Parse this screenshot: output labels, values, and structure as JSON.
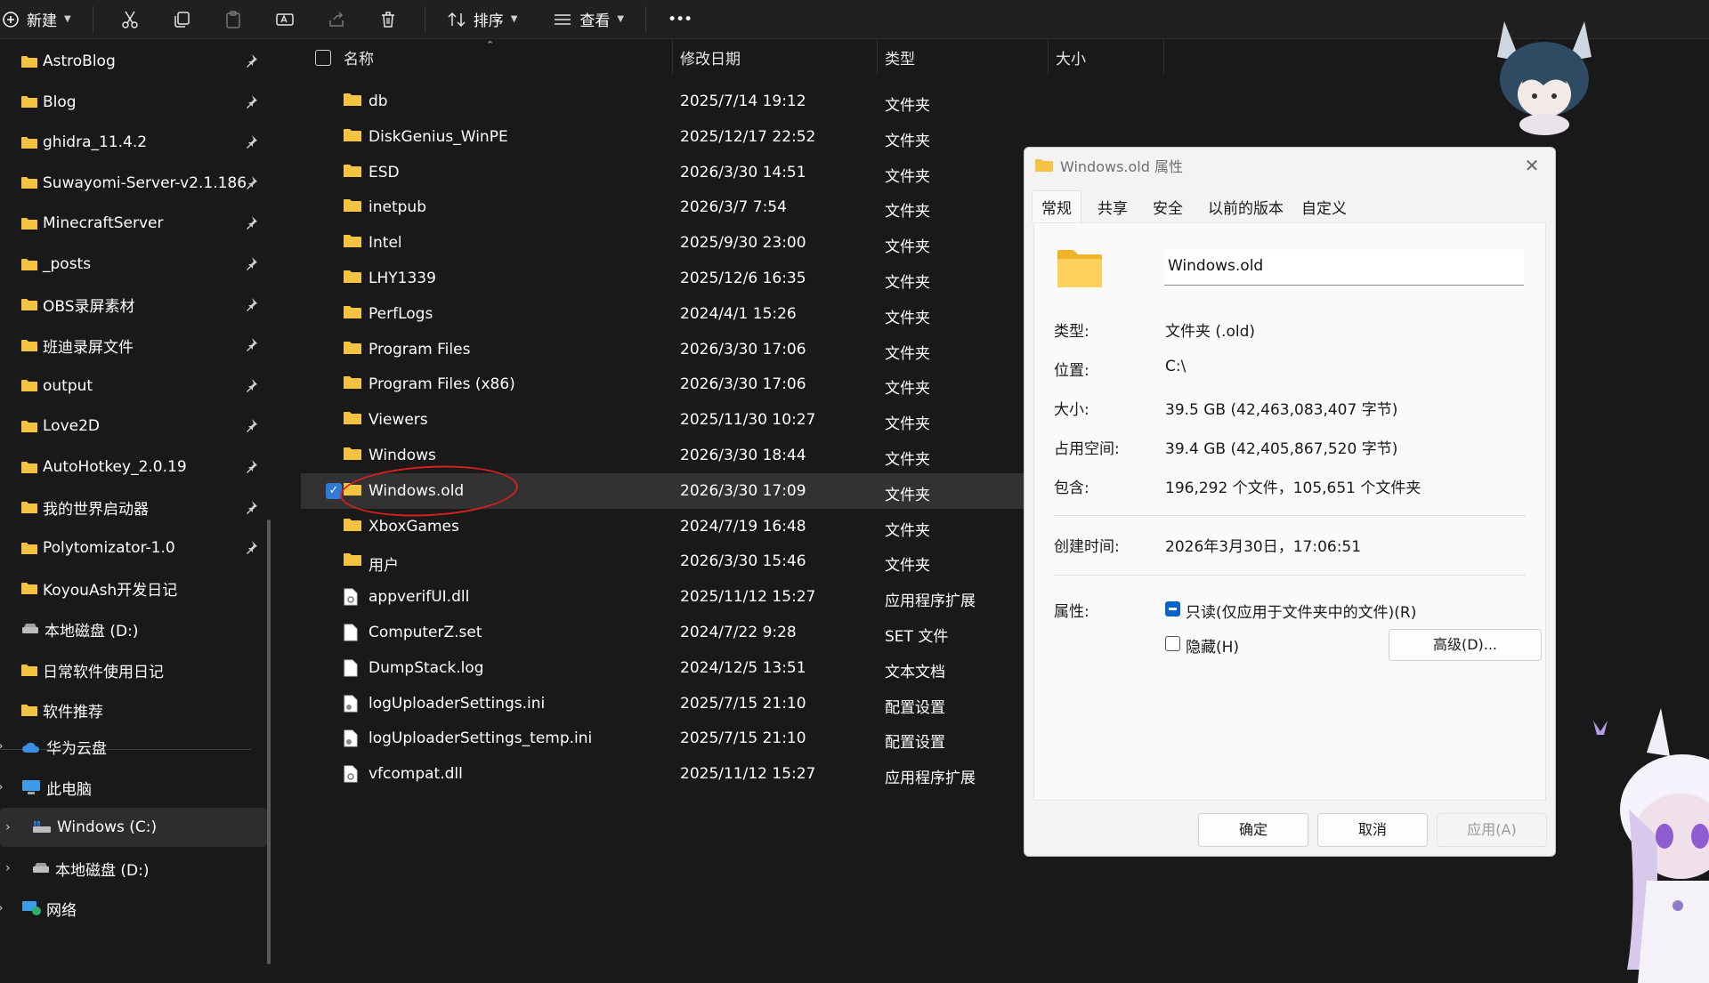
{
  "toolbar": {
    "new_label": "新建",
    "sort_label": "排序",
    "view_label": "查看",
    "more_label": "•••"
  },
  "sidebar": {
    "pinned": [
      {
        "label": "AstroBlog"
      },
      {
        "label": "Blog"
      },
      {
        "label": "ghidra_11.4.2"
      },
      {
        "label": "Suwayomi-Server-v2.1.186"
      },
      {
        "label": "MinecraftServer"
      },
      {
        "label": "_posts"
      },
      {
        "label": "OBS录屏素材"
      },
      {
        "label": "班迪录屏文件"
      },
      {
        "label": "output"
      },
      {
        "label": "Love2D"
      },
      {
        "label": "AutoHotkey_2.0.19"
      },
      {
        "label": "我的世界启动器"
      },
      {
        "label": "Polytomizator-1.0"
      },
      {
        "label": "KoyouAsh开发日记"
      },
      {
        "label": "本地磁盘 (D:)"
      },
      {
        "label": "日常软件使用日记"
      },
      {
        "label": "软件推荐"
      }
    ],
    "tree": [
      {
        "label": "华为云盘"
      },
      {
        "label": "此电脑"
      },
      {
        "label": "Windows (C:)"
      },
      {
        "label": "本地磁盘 (D:)"
      },
      {
        "label": "网络"
      }
    ]
  },
  "columns": {
    "name": "名称",
    "date": "修改日期",
    "type": "类型",
    "size": "大小"
  },
  "files": [
    {
      "name": "db",
      "date": "2025/7/14 19:12",
      "type": "文件夹",
      "kind": "folder"
    },
    {
      "name": "DiskGenius_WinPE",
      "date": "2025/12/17 22:52",
      "type": "文件夹",
      "kind": "folder"
    },
    {
      "name": "ESD",
      "date": "2026/3/30 14:51",
      "type": "文件夹",
      "kind": "folder"
    },
    {
      "name": "inetpub",
      "date": "2026/3/7 7:54",
      "type": "文件夹",
      "kind": "folder"
    },
    {
      "name": "Intel",
      "date": "2025/9/30 23:00",
      "type": "文件夹",
      "kind": "folder"
    },
    {
      "name": "LHY1339",
      "date": "2025/12/6 16:35",
      "type": "文件夹",
      "kind": "folder"
    },
    {
      "name": "PerfLogs",
      "date": "2024/4/1 15:26",
      "type": "文件夹",
      "kind": "folder"
    },
    {
      "name": "Program Files",
      "date": "2026/3/30 17:06",
      "type": "文件夹",
      "kind": "folder"
    },
    {
      "name": "Program Files (x86)",
      "date": "2026/3/30 17:06",
      "type": "文件夹",
      "kind": "folder"
    },
    {
      "name": "Viewers",
      "date": "2025/11/30 10:27",
      "type": "文件夹",
      "kind": "folder"
    },
    {
      "name": "Windows",
      "date": "2026/3/30 18:44",
      "type": "文件夹",
      "kind": "folder"
    },
    {
      "name": "Windows.old",
      "date": "2026/3/30 17:09",
      "type": "文件夹",
      "kind": "folder"
    },
    {
      "name": "XboxGames",
      "date": "2024/7/19 16:48",
      "type": "文件夹",
      "kind": "folder"
    },
    {
      "name": "用户",
      "date": "2026/3/30 15:46",
      "type": "文件夹",
      "kind": "folder"
    },
    {
      "name": "appverifUI.dll",
      "date": "2025/11/12 15:27",
      "type": "应用程序扩展",
      "kind": "dll"
    },
    {
      "name": "ComputerZ.set",
      "date": "2024/7/22 9:28",
      "type": "SET 文件",
      "kind": "file"
    },
    {
      "name": "DumpStack.log",
      "date": "2024/12/5 13:51",
      "type": "文本文档",
      "kind": "file"
    },
    {
      "name": "logUploaderSettings.ini",
      "date": "2025/7/15 21:10",
      "type": "配置设置",
      "kind": "ini"
    },
    {
      "name": "logUploaderSettings_temp.ini",
      "date": "2025/7/15 21:10",
      "type": "配置设置",
      "kind": "ini"
    },
    {
      "name": "vfcompat.dll",
      "date": "2025/11/12 15:27",
      "type": "应用程序扩展",
      "kind": "dll"
    }
  ],
  "selected_index": 11,
  "dialog": {
    "title": "Windows.old 属性",
    "tabs": [
      "常规",
      "共享",
      "安全",
      "以前的版本",
      "自定义"
    ],
    "active_tab": "常规",
    "name_value": "Windows.old",
    "props": {
      "type_label": "类型:",
      "type_value": "文件夹 (.old)",
      "location_label": "位置:",
      "location_value": "C:\\",
      "size_label": "大小:",
      "size_value": "39.5 GB (42,463,083,407 字节)",
      "disk_label": "占用空间:",
      "disk_value": "39.4 GB (42,405,867,520 字节)",
      "contains_label": "包含:",
      "contains_value": "196,292 个文件，105,651 个文件夹",
      "created_label": "创建时间:",
      "created_value": "2026年3月30日，17:06:51",
      "attr_label": "属性:"
    },
    "readonly_label": "只读(仅应用于文件夹中的文件)(R)",
    "readonly_checked": "indeterminate",
    "hidden_label": "隐藏(H)",
    "hidden_checked": false,
    "advanced_label": "高级(D)...",
    "ok_label": "确定",
    "cancel_label": "取消",
    "apply_label": "应用(A)"
  },
  "colors": {
    "accent": "#2f7ad6",
    "folder": "#f5c342",
    "annotation": "#d42020"
  }
}
